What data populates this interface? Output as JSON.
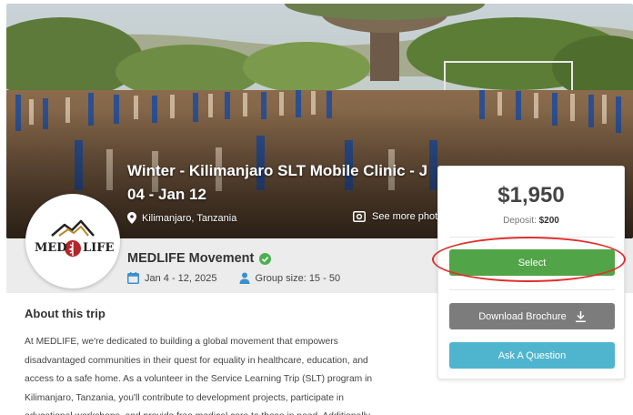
{
  "trip": {
    "title_line1": "Winter - Kilimanjaro SLT Mobile Clinic - J",
    "title_line2": "04 - Jan 12",
    "location": "Kilimanjaro, Tanzania",
    "see_more_photos": "See more phot"
  },
  "org": {
    "name": "MEDLIFE Movement",
    "logo_text_left": "MED",
    "logo_text_right": "LIFE"
  },
  "meta": {
    "dates": "Jan 4 - 12, 2025",
    "group_size": "Group size: 15 - 50"
  },
  "about": {
    "title": "About this trip",
    "lines": [
      "At MEDLIFE, we're dedicated to building a global movement that empowers",
      "disadvantaged communities in their quest for equality in healthcare, education, and",
      "access to a safe home. As a volunteer in the Service Learning Trip (SLT) program in",
      "Kilimanjaro, Tanzania, you'll contribute to development projects, participate in",
      "educational workshops, and provide free medical care to those in need. Additionally,"
    ]
  },
  "card": {
    "price": "$1,950",
    "deposit_label": "Deposit:",
    "deposit_value": "$200",
    "select_label": "Select",
    "brochure_label": "Download Brochure",
    "ask_label": "Ask A Question"
  },
  "colors": {
    "select_green": "#52a448",
    "brochure_grey": "#7c7c7c",
    "ask_blue": "#4fb5cf",
    "highlight_red": "#e0302c",
    "accent_blue": "#3a8fd0",
    "verified_green": "#4caf50"
  },
  "icons": {
    "location": "map-pin-icon",
    "photos": "camera-icon",
    "calendar": "calendar-icon",
    "group": "person-icon",
    "verified": "check-circle-icon",
    "download": "download-icon"
  }
}
